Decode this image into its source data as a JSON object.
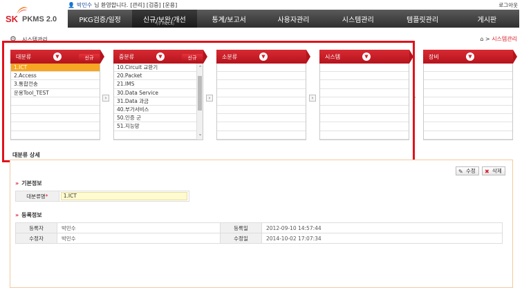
{
  "header": {
    "logo": {
      "brand": "SK",
      "product": "PKMS 2.0"
    },
    "welcome": {
      "user": "박민수",
      "text": "님 환영합니다.",
      "roles": "[관리] [검증] [운용]"
    },
    "logout": "로그아웃",
    "menu": [
      {
        "label": "PKG검증/일정",
        "sub": ""
      },
      {
        "label": "신규/보완/개선",
        "sub": "*(구 PN/CR)"
      },
      {
        "label": "통계/보고서",
        "sub": ""
      },
      {
        "label": "사용자관리",
        "sub": ""
      },
      {
        "label": "시스템관리",
        "sub": ""
      },
      {
        "label": "템플릿관리",
        "sub": ""
      },
      {
        "label": "게시판",
        "sub": ""
      }
    ]
  },
  "page": {
    "title": "시스템관리",
    "breadcrumb": {
      "current": "시스템관리"
    }
  },
  "panels": {
    "major": {
      "label": "대분류",
      "new": "신규",
      "items": [
        "1.ICT",
        "2.Access",
        "3.통합전송",
        "운용Tool_TEST"
      ],
      "selected": 0
    },
    "middle": {
      "label": "중분류",
      "new": "신규",
      "items": [
        "10.Circuit 교환기",
        "20.Packet",
        "21.IMS",
        "30.Data Service",
        "31.Data 과금",
        "40.부가서비스",
        "50.인증 군",
        "51.지능망"
      ]
    },
    "minor": {
      "label": "소분류"
    },
    "system": {
      "label": "시스템"
    },
    "equipment": {
      "label": "장비"
    }
  },
  "detail": {
    "title": "대분류 상세",
    "edit_label": "수정",
    "delete_label": "삭제",
    "basic_section": "기본정보",
    "name_label": "대분류명",
    "required_mark": "*",
    "name_value": "1.ICT",
    "reg_section": "등록정보",
    "registrant_label": "등록자",
    "registrant": "박민수",
    "reg_date_label": "등록일",
    "reg_date": "2012-09-10 14:57:44",
    "modifier_label": "수정자",
    "modifier": "박민수",
    "mod_date_label": "수정일",
    "mod_date": "2014-10-02 17:07:34"
  },
  "colors": {
    "accent": "#d8202a",
    "highlight": "#e0121b",
    "selected_row": "#f6a623"
  }
}
